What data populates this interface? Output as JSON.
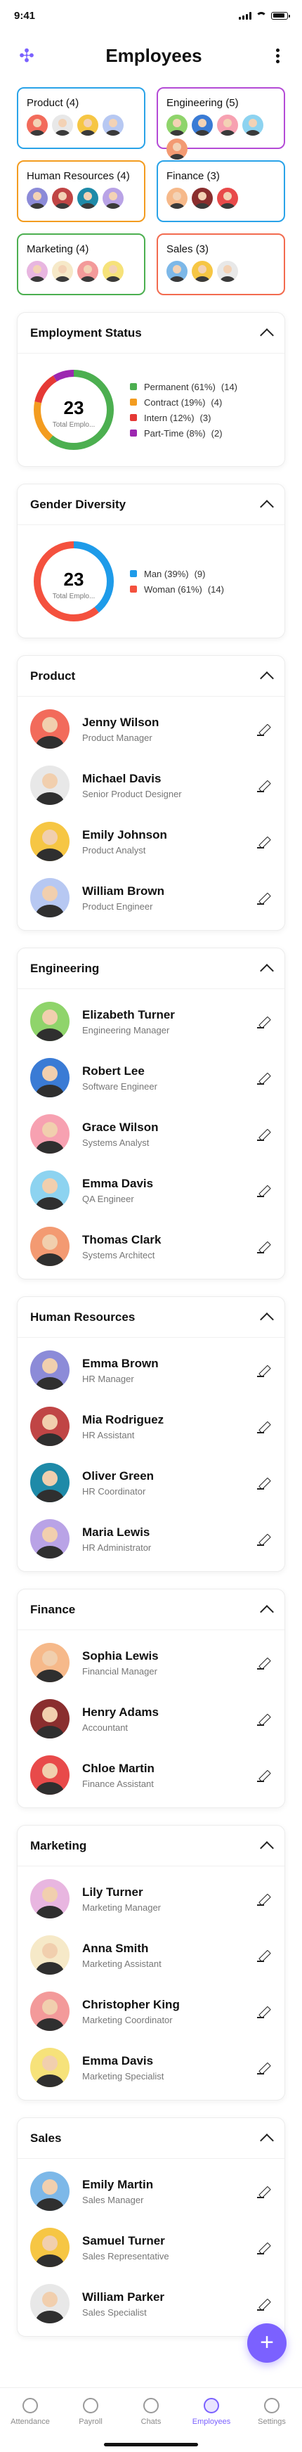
{
  "status": {
    "time": "9:41"
  },
  "header": {
    "title": "Employees"
  },
  "departments": [
    {
      "label": "Product (4)",
      "color": "#2aa3e8"
    },
    {
      "label": "Engineering (5)",
      "color": "#b44bd6"
    },
    {
      "label": "Human Resources (4)",
      "color": "#f39c20"
    },
    {
      "label": "Finance (3)",
      "color": "#2aa3e8"
    },
    {
      "label": "Marketing (4)",
      "color": "#4caf50"
    },
    {
      "label": "Sales (3)",
      "color": "#f26b4f"
    }
  ],
  "employment_status": {
    "title": "Employment Status",
    "total": "23",
    "total_label": "Total Emplo...",
    "items": [
      {
        "label": "Permanent (61%)",
        "count": "(14)",
        "color": "#4caf50",
        "value": 14
      },
      {
        "label": "Contract (19%)",
        "count": "(4)",
        "color": "#f39c20",
        "value": 4
      },
      {
        "label": "Intern (12%)",
        "count": "(3)",
        "color": "#e53935",
        "value": 3
      },
      {
        "label": "Part-Time (8%)",
        "count": "(2)",
        "color": "#9c27b0",
        "value": 2
      }
    ]
  },
  "gender_diversity": {
    "title": "Gender Diversity",
    "total": "23",
    "total_label": "Total Emplo...",
    "items": [
      {
        "label": "Man (39%)",
        "count": "(9)",
        "color": "#1e9be9",
        "value": 9
      },
      {
        "label": "Woman (61%)",
        "count": "(14)",
        "color": "#f4513e",
        "value": 14
      }
    ]
  },
  "groups": [
    {
      "title": "Product",
      "members": [
        {
          "name": "Jenny Wilson",
          "role": "Product Manager",
          "bg": "#f26b5b"
        },
        {
          "name": "Michael Davis",
          "role": "Senior Product Designer",
          "bg": "#e8e8e8"
        },
        {
          "name": "Emily Johnson",
          "role": "Product Analyst",
          "bg": "#f6c644"
        },
        {
          "name": "William Brown",
          "role": "Product Engineer",
          "bg": "#b7c8f2"
        }
      ]
    },
    {
      "title": "Engineering",
      "members": [
        {
          "name": "Elizabeth Turner",
          "role": "Engineering Manager",
          "bg": "#8fd46b"
        },
        {
          "name": "Robert Lee",
          "role": "Software Engineer",
          "bg": "#3a7bd5"
        },
        {
          "name": "Grace Wilson",
          "role": "Systems Analyst",
          "bg": "#f7a1b1"
        },
        {
          "name": "Emma Davis",
          "role": "QA Engineer",
          "bg": "#8dd3f0"
        },
        {
          "name": "Thomas Clark",
          "role": "Systems Architect",
          "bg": "#f39a72"
        }
      ]
    },
    {
      "title": "Human Resources",
      "members": [
        {
          "name": "Emma Brown",
          "role": "HR Manager",
          "bg": "#8c8bd8"
        },
        {
          "name": "Mia Rodriguez",
          "role": "HR Assistant",
          "bg": "#c04545"
        },
        {
          "name": "Oliver Green",
          "role": "HR Coordinator",
          "bg": "#1e8aa8"
        },
        {
          "name": "Maria Lewis",
          "role": "HR Administrator",
          "bg": "#b9a3e6"
        }
      ]
    },
    {
      "title": "Finance",
      "members": [
        {
          "name": "Sophia Lewis",
          "role": "Financial Manager",
          "bg": "#f6b98a"
        },
        {
          "name": "Henry Adams",
          "role": "Accountant",
          "bg": "#8a2e2e"
        },
        {
          "name": "Chloe Martin",
          "role": "Finance Assistant",
          "bg": "#e84a4a"
        }
      ]
    },
    {
      "title": "Marketing",
      "members": [
        {
          "name": "Lily Turner",
          "role": "Marketing Manager",
          "bg": "#e8b6e0"
        },
        {
          "name": "Anna Smith",
          "role": "Marketing Assistant",
          "bg": "#f6e9c8"
        },
        {
          "name": "Christopher King",
          "role": "Marketing Coordinator",
          "bg": "#f39a9a"
        },
        {
          "name": "Emma Davis",
          "role": "Marketing Specialist",
          "bg": "#f6e27a"
        }
      ]
    },
    {
      "title": "Sales",
      "members": [
        {
          "name": "Emily Martin",
          "role": "Sales Manager",
          "bg": "#7db8e8"
        },
        {
          "name": "Samuel Turner",
          "role": "Sales Representative",
          "bg": "#f6c644"
        },
        {
          "name": "William Parker",
          "role": "Sales Specialist",
          "bg": "#e8e8e8"
        }
      ]
    }
  ],
  "tabbar": {
    "items": [
      {
        "label": "Attendance",
        "icon": "clock-icon"
      },
      {
        "label": "Payroll",
        "icon": "dollar-icon"
      },
      {
        "label": "Chats",
        "icon": "chat-icon"
      },
      {
        "label": "Employees",
        "icon": "people-icon"
      },
      {
        "label": "Settings",
        "icon": "gear-icon"
      }
    ],
    "active_index": 3
  },
  "fab": {
    "label": "+"
  }
}
